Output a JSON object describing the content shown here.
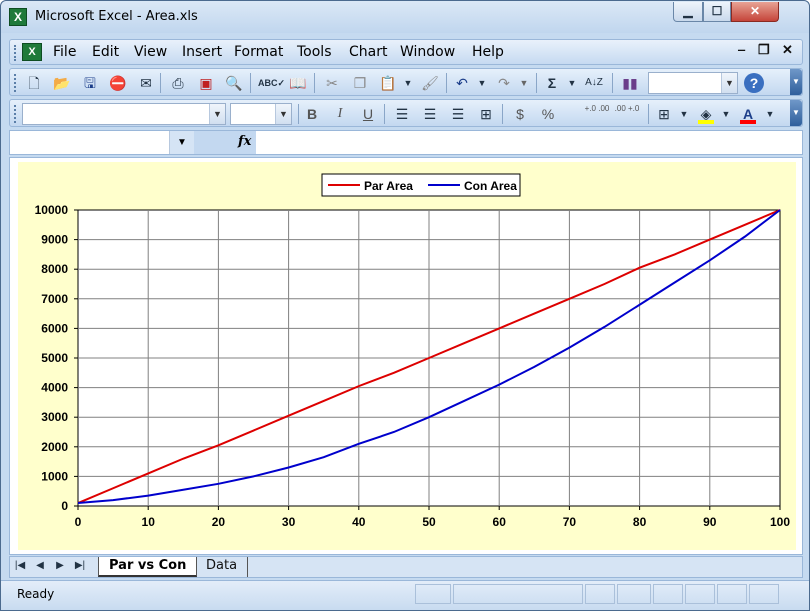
{
  "window": {
    "title": "Microsoft Excel - Area.xls",
    "app_icon_letter": "X",
    "controls": {
      "minimize": "▁",
      "maximize": "☐",
      "close": "✕"
    }
  },
  "menubar": {
    "doc_icon_letter": "X",
    "items": [
      "File",
      "Edit",
      "View",
      "Insert",
      "Format",
      "Tools",
      "Chart",
      "Window",
      "Help"
    ],
    "doc_controls": {
      "minimize": "‒",
      "restore": "❐",
      "close": "✕"
    }
  },
  "toolbar_standard": {
    "icons": [
      "new-icon",
      "open-icon",
      "save-icon",
      "permission-icon",
      "email-icon",
      "print-icon",
      "pdf-icon",
      "print-preview-icon",
      "spelling-icon",
      "research-icon",
      "cut-icon",
      "copy-icon",
      "paste-icon",
      "format-painter-icon",
      "undo-icon",
      "redo-icon",
      "autosum-icon",
      "sort-icon",
      "chart-wizard-icon",
      "help-icon"
    ],
    "zoom_value": ""
  },
  "toolbar_formatting": {
    "font_name": "",
    "font_size": "",
    "bold": "B",
    "italic": "I",
    "underline": "U",
    "currency": "$",
    "percent": "%",
    "increase_decimal": "+.0 .00",
    "decrease_decimal": ".00 +.0",
    "fill_color": "#ffff00",
    "font_color": "#ff0000",
    "font_color_letter": "A"
  },
  "formula_bar": {
    "name_box": "",
    "fx_label": "fx",
    "formula": ""
  },
  "chart_data": {
    "type": "line",
    "x": [
      0,
      5,
      10,
      15,
      20,
      25,
      30,
      35,
      40,
      45,
      50,
      55,
      60,
      65,
      70,
      75,
      80,
      85,
      90,
      95,
      100
    ],
    "series": [
      {
        "name": "Par Area",
        "color": "#dd0000",
        "values": [
          100,
          600,
          1100,
          1600,
          2050,
          2550,
          3050,
          3550,
          4050,
          4500,
          5000,
          5500,
          6000,
          6500,
          7000,
          7500,
          8050,
          8500,
          9000,
          9500,
          10000
        ]
      },
      {
        "name": "Con Area",
        "color": "#0000cc",
        "values": [
          100,
          200,
          350,
          550,
          750,
          1000,
          1300,
          1650,
          2100,
          2500,
          3000,
          3550,
          4100,
          4700,
          5350,
          6050,
          6800,
          7550,
          8300,
          9100,
          10000
        ]
      }
    ],
    "xlim": [
      0,
      100
    ],
    "ylim": [
      0,
      10000
    ],
    "xticks": [
      "0",
      "10",
      "20",
      "30",
      "40",
      "50",
      "60",
      "70",
      "80",
      "90",
      "100"
    ],
    "yticks": [
      "0",
      "1000",
      "2000",
      "3000",
      "4000",
      "5000",
      "6000",
      "7000",
      "8000",
      "9000",
      "10000"
    ],
    "grid": true,
    "legend_position": "top-center",
    "plot_background": "#ffffff",
    "chart_background": "#ffffcc"
  },
  "sheet_tabs": {
    "nav": [
      "|◀",
      "◀",
      "▶",
      "▶|"
    ],
    "tabs": [
      {
        "label": "Par vs Con",
        "active": true
      },
      {
        "label": "Data",
        "active": false
      }
    ]
  },
  "statusbar": {
    "text": "Ready"
  }
}
